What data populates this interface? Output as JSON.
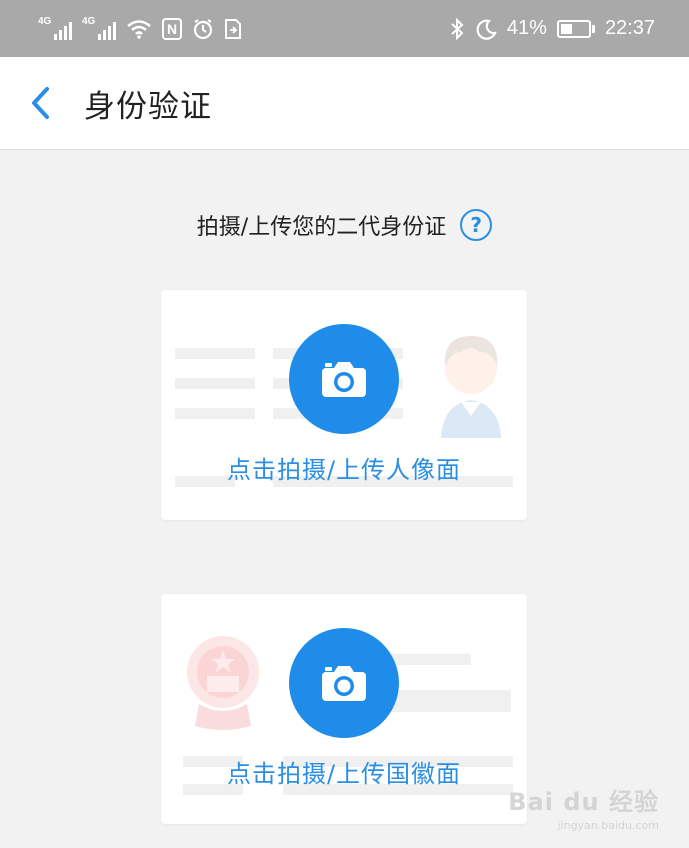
{
  "status_bar": {
    "signal1_tag": "4G",
    "signal2_tag": "4G",
    "icons": [
      "signal-4g-icon",
      "signal-4g-icon",
      "wifi-icon",
      "nfc-icon",
      "alarm-icon",
      "sim-icon",
      "bluetooth-icon",
      "moon-icon",
      "battery-icon"
    ],
    "battery": "41%",
    "battery_level": 0.41,
    "time": "22:37"
  },
  "nav": {
    "title": "身份验证"
  },
  "prompt": {
    "text": "拍摄/上传您的二代身份证",
    "help_symbol": "?"
  },
  "cards": {
    "front": {
      "label": "点击拍摄/上传人像面"
    },
    "back": {
      "label": "点击拍摄/上传国徽面"
    }
  },
  "watermark": {
    "logo": "Bai du 经验",
    "url": "jingyan.baidu.com"
  },
  "colors": {
    "accent": "#1e8ce8",
    "status_bar": "#a9a9a9",
    "background": "#f2f2f2"
  }
}
